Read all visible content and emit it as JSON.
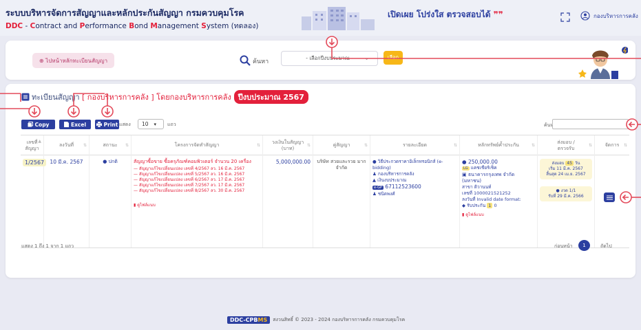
{
  "header": {
    "title_th": "ระบบบริหารจัดการสัญญาและหลักประกันสัญญา กรมควบคุมโรค",
    "title_en_ddc": "DDC",
    "title_en_sep": " - ",
    "title_en_c": "C",
    "title_en_ontract": "ontract and ",
    "title_en_p": "P",
    "title_en_erformance": "erformance ",
    "title_en_b": "B",
    "title_en_ond": "ond ",
    "title_en_m": "M",
    "title_en_anagement": "anagement ",
    "title_en_s": "S",
    "title_en_ystem": "ystem (ทดลอง)",
    "tagline": "เปิดเผย โปร่งใส ตรวจสอบได้",
    "tagline_quote": "❞❞",
    "user": "กองบริหารการคลัง"
  },
  "search": {
    "home_button": "⊕ ไปหน้าหลักทะเบียนสัญญา",
    "label": "ค้นหา",
    "year_select": "- เลือกปีงบประมาณ -",
    "select_button": "เลือก"
  },
  "list": {
    "title_prefix": "ทะเบียนสัญญา",
    "title_org": "[ กองบริหารการคลัง ]",
    "title_by": "โดยกองบริหารการคลัง",
    "title_year": "ปีงบประมาณ 2567"
  },
  "toolbar": {
    "copy": "Copy",
    "excel": "Excel",
    "print": "Print",
    "show_prefix": "แสดง",
    "show_value": "10",
    "show_suffix": "แถว",
    "filter_label": "ค้นหา:"
  },
  "table": {
    "columns": [
      "เลขที่ สัญญา",
      "ลงวันที่",
      "สถานะ",
      "โครงการจัดทำสัญญา",
      "วงเงินในสัญญา (บาท)",
      "คู่สัญญา",
      "รายละเอียด",
      "หลักทรัพย์ค้ำประกัน",
      "ส่งมอบ /ตรวจรับ",
      "จัดการ"
    ],
    "row": {
      "contract_no": "1/2567",
      "date": "10 มี.ค. 2567",
      "status": "ปกติ",
      "project_title": "สัญญาซื้อขาย ซื้อครุภัณฑ์คอมพิวเตอร์ จำนวน 20 เครื่อง",
      "sub_contracts": [
        "— สัญญาแก้ไขเปลี่ยนแปลง เลขที่ 4/2567 ลว. 16 มี.ค. 2567",
        "— สัญญาแก้ไขเปลี่ยนแปลง เลขที่ 5/2567 ลว. 16 มี.ค. 2567",
        "— สัญญาแก้ไขเปลี่ยนแปลง เลขที่ 6/2567 ลว. 17 มี.ค. 2567",
        "— สัญญาแก้ไขเปลี่ยนแปลง เลขที่ 7/2567 ลว. 17 มี.ค. 2567",
        "— สัญญาแก้ไขเปลี่ยนแปลง เลขที่ 8/2567 ลว. 30 มี.ค. 2567"
      ],
      "project_attach": "ดูไฟล์แนบ",
      "amount": "5,000,000.00",
      "party": "บริษัท สวยและรวย มาก จำกัด",
      "detail_method": "วิธีประกวดราคาอิเล็กทรอนิกส์ (e-bidding)",
      "detail_org": "กองบริหารการคลัง",
      "detail_budget": "เงินงบประมาณ",
      "detail_egp_tag": "e-GP",
      "detail_egp": "67112523600",
      "detail_user": "ชนิดพงศ์",
      "guarantee_amount": "250,000.00",
      "guarantee_tag": "LG",
      "guarantee_type": "แคชเชียร์เช็ค",
      "guarantee_bank": "ธนาคารกรุงเทพ จำกัด (มหาชน)",
      "guarantee_branch": "สาขา ติวานนท์",
      "guarantee_no": "เลขที่ 1000021521252",
      "guarantee_date": "ลงวันที่ Invalid date format:",
      "guarantee_received_label": "รับประกัน",
      "guarantee_received_count": "1",
      "guarantee_received_zero": "0",
      "guarantee_attach": "ดูไฟล์แนบ",
      "delivery_days_label": "ส่งมอบ",
      "delivery_days": "45",
      "delivery_days_unit": "วัน",
      "delivery_start": "เริ่ม 11 มี.ค. 2567",
      "delivery_end": "สิ้นสุด 24 เม.ย. 2567",
      "delivery_period": "งวด 1/1",
      "delivery_received": "รับที่ 29 มี.ค. 2566"
    }
  },
  "pagination": {
    "summary": "แสดง 1 ถึง 1 จาก 1 แถว",
    "prev": "ก่อนหน้า",
    "current": "1",
    "next": "ถัดไป"
  },
  "footer": {
    "logo_main": "DDC-CPB",
    "logo_sfx": "MS",
    "text": "สงวนสิทธิ์ © 2023 - 2024 กองบริหารการคลัง กรมควบคุมโรค"
  },
  "colors": {
    "primary": "#2c3fa0",
    "accent_red": "#e3203b",
    "annotation": "#e34a5a",
    "yellow": "#f7b718"
  }
}
